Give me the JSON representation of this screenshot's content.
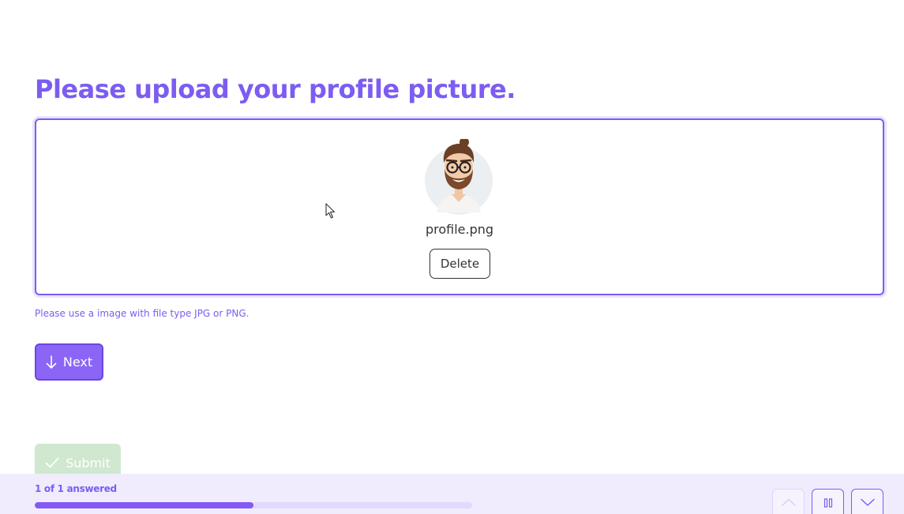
{
  "question": {
    "title": "Please upload your profile picture.",
    "helper_text": "Please use a image with file type JPG or PNG."
  },
  "upload": {
    "file_name": "profile.png",
    "delete_label": "Delete"
  },
  "actions": {
    "next_label": "Next",
    "submit_label": "Submit"
  },
  "footer": {
    "progress_text": "1 of 1 answered",
    "progress_fraction": 0.5
  },
  "colors": {
    "accent": "#7c5cf2",
    "submit_disabled": "#cfe8cf",
    "footer_bg": "#f1ecfd"
  },
  "icons": {
    "next": "arrow-down-icon",
    "submit": "check-icon",
    "nav_up": "chevron-up-icon",
    "nav_pause": "pause-icon",
    "nav_down": "chevron-down-icon"
  }
}
